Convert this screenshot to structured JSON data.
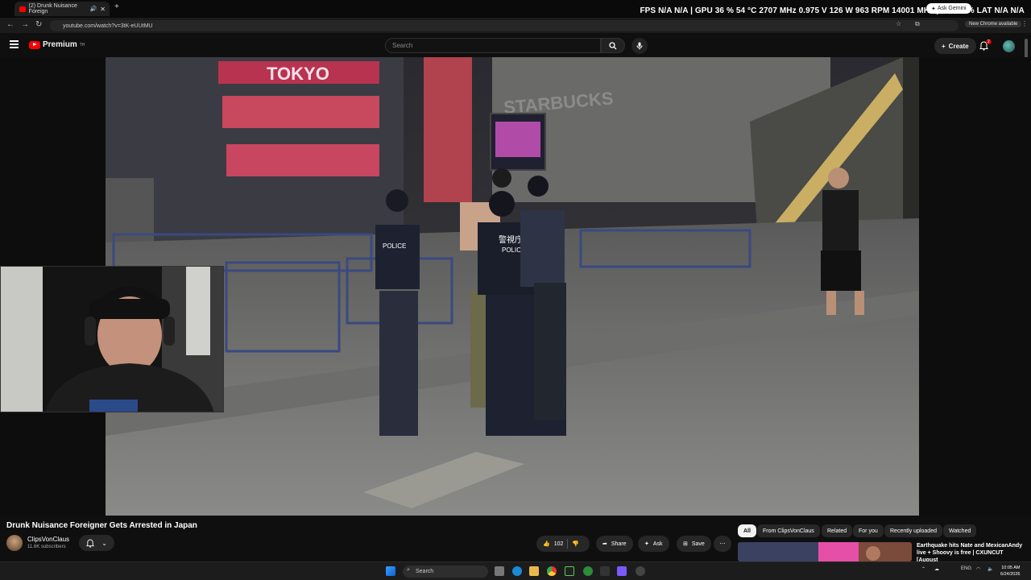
{
  "browser": {
    "tab_title": "(2) Drunk Nuisance Foreign",
    "url": "youtube.com/watch?v=3tK-eUUtMU",
    "ask_gemini": "Ask Gemini",
    "new_chrome": "New Chrome available"
  },
  "hud": "FPS  N/A  N/A  |  GPU  36 %  54 °C  2707 MHz  0.975 V  126 W  963 RPM  14001 MHz  |  CPU  6 %  LAT  N/A  N/A",
  "youtube": {
    "brand": "Premium",
    "brand_sup": "TH",
    "search_placeholder": "Search",
    "create_label": "Create",
    "notif_count": "2"
  },
  "video": {
    "title": "Drunk Nuisance Foreigner Gets Arrested in Japan",
    "channel": "ClipsVonClaus",
    "subscribers": "11.6K subscribers",
    "likes": "102",
    "share": "Share",
    "ask": "Ask",
    "save": "Save",
    "scene_signs": [
      "TOKYO",
      "STARBUCKS",
      "POLICE",
      "POLICE",
      "警視庁"
    ]
  },
  "chips": [
    "All",
    "From ClipsVonClaus",
    "Related",
    "For you",
    "Recently uploaded",
    "Watched"
  ],
  "recommendation": {
    "title": "Earthquake hits Nate and MexicanAndy live + Shoovy is free | CXUNCUT [August"
  },
  "taskbar": {
    "search_placeholder": "Search",
    "lang": "ENG",
    "time": "10:05 AM",
    "date": "6/24/2026"
  }
}
